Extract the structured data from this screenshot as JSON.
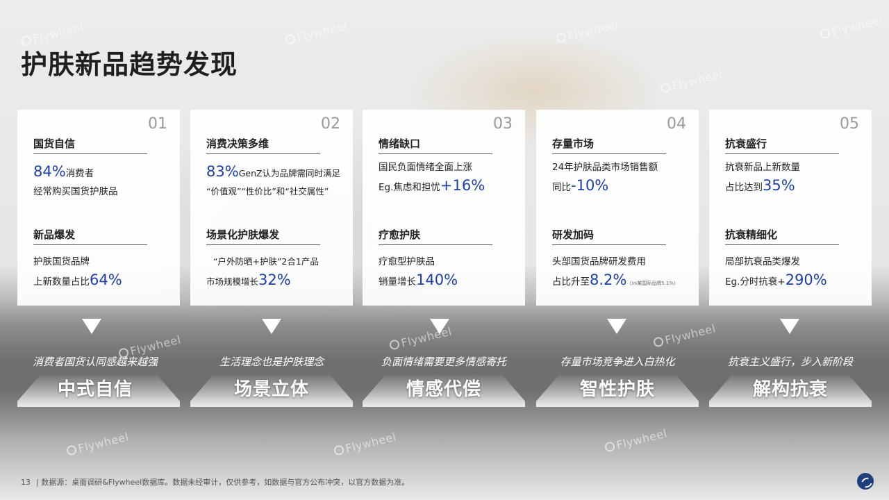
{
  "page": {
    "title": "护肤新品趋势发现",
    "page_number": "13",
    "source": "数据源：桌面调研&Flywheel数据库。数据未经审计，仅供参考，如数据与官方公布冲突，以官方数据为准。",
    "watermark": "Flywheel",
    "colors": {
      "highlight": "#1f3f9e",
      "title": "#1f1f1f"
    }
  },
  "cards": [
    {
      "num": "01",
      "s1_head": "国货自信",
      "s1_hl": "84%",
      "s1_a": "消费者",
      "s1_b": "经常购买国货护肤品",
      "s2_head": "新品爆发",
      "s2_a": "护肤国货品牌",
      "s2_b": "上新数量占比",
      "s2_hl": "64%",
      "caption": "消费者国货认同感越来越强",
      "band": "中式自信"
    },
    {
      "num": "02",
      "s1_head": "消费决策多维",
      "s1_hl": "83%",
      "s1_a": "GenZ认为品牌需同时满足",
      "s1_b": "“价值观”“性价比”和“社交属性”",
      "s2_head": "场景化护肤爆发",
      "s2_a": "“户外防晒+护肤”2合1产品",
      "s2_b": "市场规模增长",
      "s2_hl": "32%",
      "caption": "生活理念也是护肤理念",
      "band": "场景立体"
    },
    {
      "num": "03",
      "s1_head": "情绪缺口",
      "s1_a": "国民负面情绪全面上涨",
      "s1_b": "Eg.焦虑和担忧",
      "s1_hl": "+16%",
      "s2_head": "疗愈护肤",
      "s2_a": "疗愈型护肤品",
      "s2_b": "销量增长",
      "s2_hl": "140%",
      "caption": "负面情绪需要更多情感寄托",
      "band": "情感代偿"
    },
    {
      "num": "04",
      "s1_head": "存量市场",
      "s1_a": "24年护肤品类市场销售额",
      "s1_b": "同比",
      "s1_hl": "-10%",
      "s2_head": "研发加码",
      "s2_a": "头部国货品牌研发费用",
      "s2_b": "占比升至",
      "s2_hl": "8.2%",
      "s2_note": "（vs某国际品牌5.1%）",
      "caption": "存量市场竞争进入白热化",
      "band": "智性护肤"
    },
    {
      "num": "05",
      "s1_head": "抗衰盛行",
      "s1_a": "抗衰新品上新数量",
      "s1_b": "占比达到",
      "s1_hl": "35%",
      "s2_head": "抗衰精细化",
      "s2_a": "局部抗衰品类爆发",
      "s2_b": "Eg.分时抗衰+",
      "s2_hl": "290%",
      "caption": "抗衰主义盛行，步入新阶段",
      "band": "解构抗衰"
    }
  ]
}
